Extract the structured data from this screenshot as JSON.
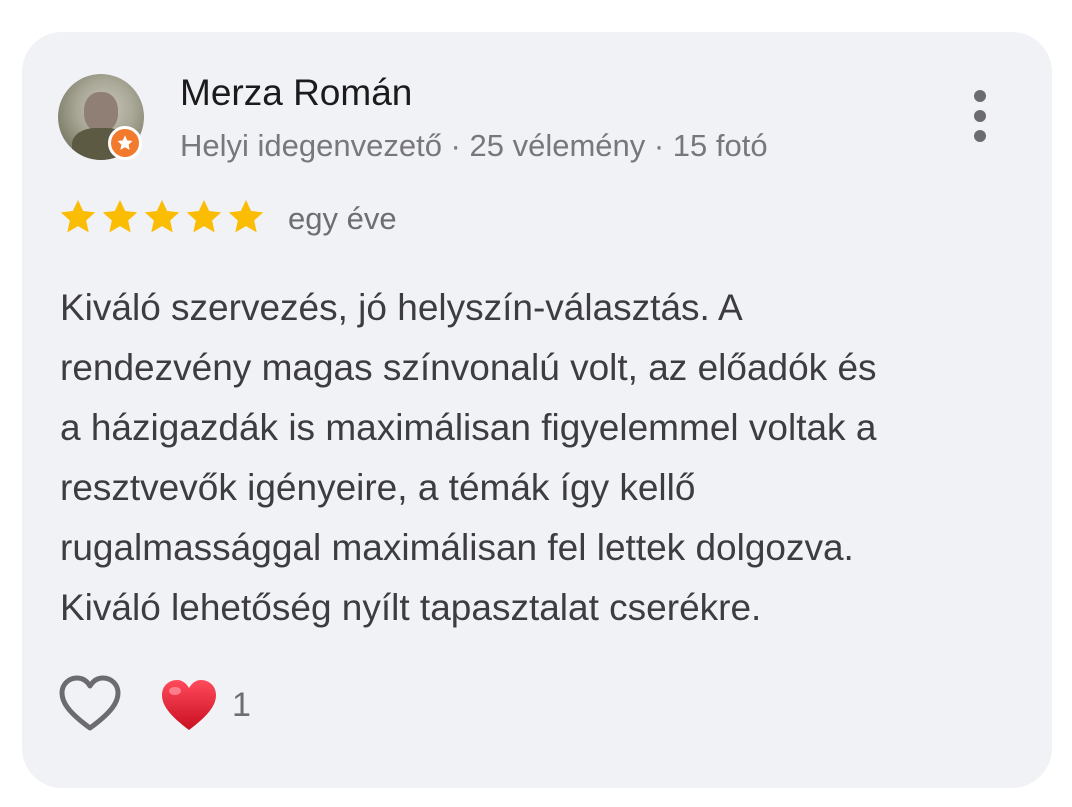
{
  "reviewer": {
    "name": "Merza Román",
    "meta": "Helyi idegenvezető · 25 vélemény · 15 fotó"
  },
  "rating": {
    "stars": 5,
    "max": 5,
    "time_ago": "egy éve"
  },
  "review": {
    "lines": [
      "Kiváló szervezés, jó helyszín-választás. A",
      "rendezvény magas színvonalú volt, az előadók és",
      "a házigazdák is maximálisan figyelemmel voltak a",
      "resztvevők igényeire, a témák így kellő",
      "rugalmassággal maximálisan fel lettek dolgozva.",
      "Kiváló lehetőség nyílt tapasztalat cserékre."
    ]
  },
  "reactions": {
    "heart_count": "1"
  },
  "colors": {
    "card_bg": "#f1f2f5",
    "star": "#fbbc04",
    "badge": "#f27a2c",
    "heart": "#e5142c"
  },
  "icons": {
    "more": "more-vert-icon",
    "like": "heart-outline-icon",
    "reaction": "red-heart-emoji",
    "badge": "local-guide-star-icon",
    "rating": "star-icon"
  }
}
